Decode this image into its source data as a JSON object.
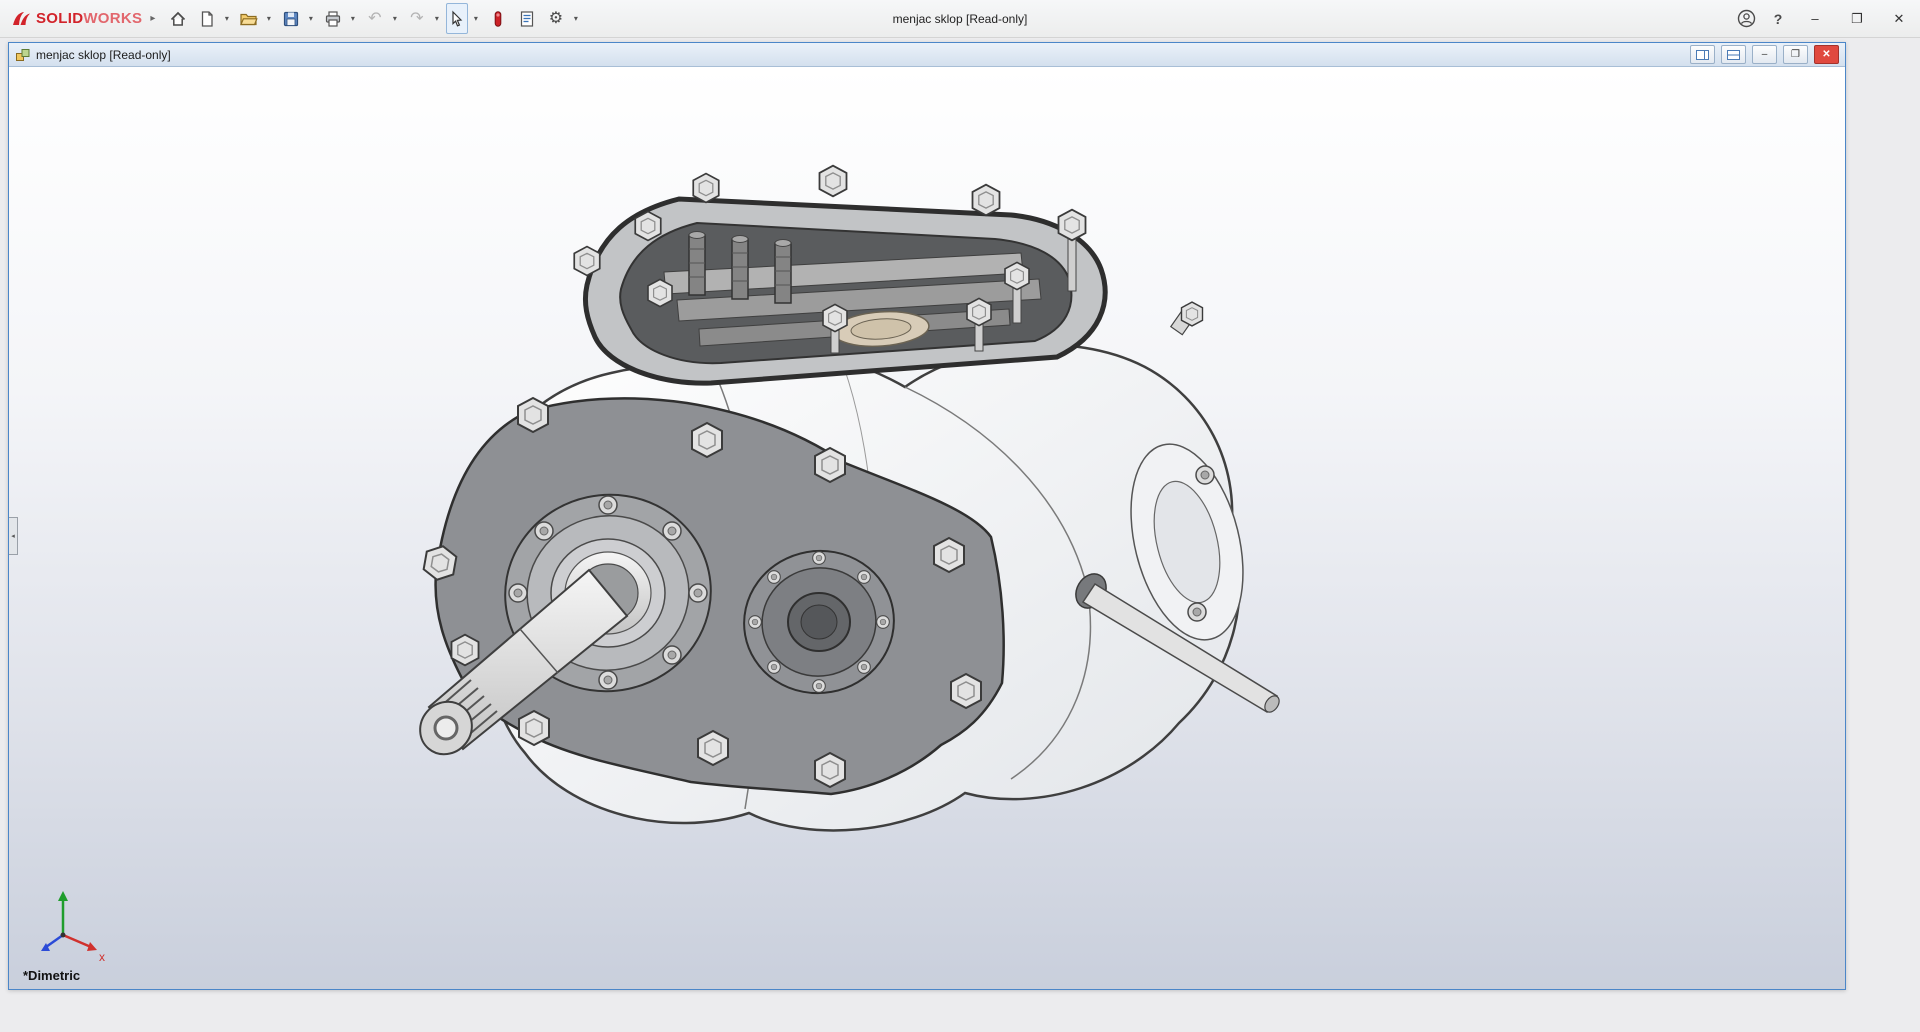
{
  "app_bar": {
    "brand": {
      "name_bold": "SOLID",
      "name_light": "WORKS"
    },
    "title": "menjac sklop [Read-only]",
    "toolbar": {
      "buttons": [
        "home",
        "new-document",
        "open",
        "save",
        "print",
        "undo",
        "redo",
        "select",
        "rebuild",
        "file-properties",
        "options"
      ]
    }
  },
  "icons": {
    "expand": "▸",
    "dropdown": "▾",
    "undo": "↶",
    "redo": "↷",
    "gear": "⚙",
    "help": "?",
    "minimize": "–",
    "maximize": "❐",
    "restore": "❐",
    "close": "✕"
  },
  "document_window": {
    "title": "menjac sklop [Read-only]"
  },
  "viewport": {
    "view_orientation": "*Dimetric",
    "triad": {
      "x_label": "x"
    },
    "model": "gearbox assembly (menjac sklop)"
  },
  "colors": {
    "brand_red": "#d2232a",
    "doc_border": "#4b86c8",
    "close_red": "#e0493f",
    "viewport_gradient_top": "#ffffff",
    "viewport_gradient_bottom": "#c9cfdc"
  }
}
